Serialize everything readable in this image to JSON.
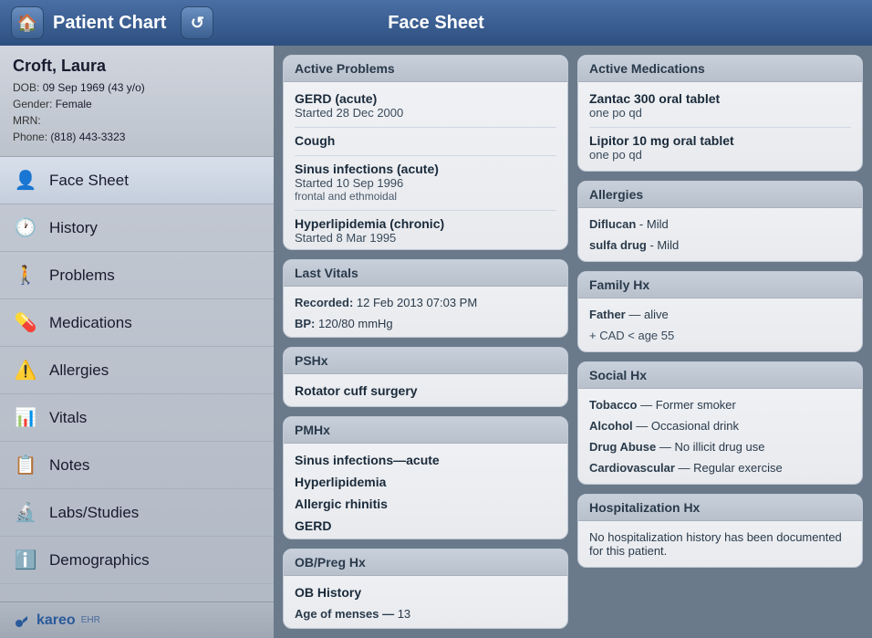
{
  "header": {
    "left_title": "Patient Chart",
    "center_title": "Face Sheet",
    "home_icon": "🏠",
    "refresh_icon": "↺"
  },
  "patient": {
    "name": "Croft, Laura",
    "dob_label": "DOB:",
    "dob_value": "09 Sep 1969 (43 y/o)",
    "gender_label": "Gender:",
    "gender_value": "Female",
    "mrn_label": "MRN:",
    "mrn_value": "",
    "phone_label": "Phone:",
    "phone_value": "(818) 443-3323"
  },
  "nav": {
    "items": [
      {
        "id": "face-sheet",
        "label": "Face Sheet",
        "icon": "👤",
        "active": true
      },
      {
        "id": "history",
        "label": "History",
        "icon": "🕐"
      },
      {
        "id": "problems",
        "label": "Problems",
        "icon": "🚶"
      },
      {
        "id": "medications",
        "label": "Medications",
        "icon": "💊"
      },
      {
        "id": "allergies",
        "label": "Allergies",
        "icon": "⚠️"
      },
      {
        "id": "vitals",
        "label": "Vitals",
        "icon": "📊"
      },
      {
        "id": "notes",
        "label": "Notes",
        "icon": "📋"
      },
      {
        "id": "labs-studies",
        "label": "Labs/Studies",
        "icon": "🔬"
      },
      {
        "id": "demographics",
        "label": "Demographics",
        "icon": "ℹ️"
      }
    ]
  },
  "footer": {
    "logo": "kareo",
    "sub": "EHR"
  },
  "cards": {
    "left": [
      {
        "id": "active-problems",
        "header": "Active Problems",
        "items": [
          {
            "title": "GERD (acute)",
            "sub": "Started 28 Dec 2000"
          },
          {
            "title": "Cough",
            "sub": ""
          },
          {
            "title": "Sinus infections (acute)",
            "sub": "Started 10 Sep 1996",
            "detail": "frontal and ethmoidal"
          },
          {
            "title": "Hyperlipidemia (chronic)",
            "sub": "Started 8 Mar 1995"
          }
        ]
      },
      {
        "id": "last-vitals",
        "header": "Last Vitals",
        "items": [
          {
            "bold_label": "Recorded:",
            "value": " 12 Feb 2013 07:03 PM"
          },
          {
            "bold_label": "BP:",
            "value": " 120/80 mmHg"
          }
        ]
      },
      {
        "id": "pshx",
        "header": "PSHx",
        "items": [
          {
            "title": "Rotator cuff surgery"
          }
        ]
      },
      {
        "id": "pmhx",
        "header": "PMHx",
        "items": [
          {
            "title": "Sinus infections",
            "dash": "—",
            "value": "acute"
          },
          {
            "title": "Hyperlipidemia"
          },
          {
            "title": "Allergic rhinitis"
          },
          {
            "title": "GERD"
          }
        ]
      },
      {
        "id": "ob-preg-hx",
        "header": "OB/Preg Hx",
        "items": [
          {
            "title": "OB History"
          },
          {
            "bold_label": "Age of menses —",
            "value": " 13"
          }
        ]
      }
    ],
    "right": [
      {
        "id": "active-medications",
        "header": "Active Medications",
        "items": [
          {
            "title": "Zantac 300 oral tablet",
            "sub": "one po qd"
          },
          {
            "title": "Lipitor 10 mg oral tablet",
            "sub": "one po qd"
          }
        ]
      },
      {
        "id": "allergies",
        "header": "Allergies",
        "items": [
          {
            "bold": "Diflucan",
            "dash": " - ",
            "value": "Mild"
          },
          {
            "bold": "sulfa drug",
            "dash": " - ",
            "value": "Mild"
          }
        ]
      },
      {
        "id": "family-hx",
        "header": "Family Hx",
        "items": [
          {
            "bold": "Father",
            "dash": " — ",
            "value": "alive"
          },
          {
            "sub": "+ CAD < age 55"
          }
        ]
      },
      {
        "id": "social-hx",
        "header": "Social Hx",
        "items": [
          {
            "bold": "Tobacco",
            "dash": " — ",
            "value": "Former smoker"
          },
          {
            "bold": "Alcohol",
            "dash": " — ",
            "value": "Occasional drink"
          },
          {
            "bold": "Drug Abuse",
            "dash": " — ",
            "value": "No illicit drug use"
          },
          {
            "bold": "Cardiovascular",
            "dash": " — ",
            "value": "Regular exercise"
          }
        ]
      },
      {
        "id": "hospitalization-hx",
        "header": "Hospitalization Hx",
        "items": [
          {
            "text": "No hospitalization history has been documented for this patient."
          }
        ]
      }
    ]
  }
}
